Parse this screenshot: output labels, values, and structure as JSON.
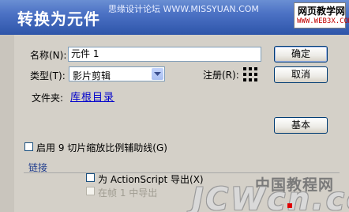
{
  "window": {
    "title": "转换为元件",
    "watermark_top": "思缘设计论坛 WWW.MISSYUAN.COM",
    "watermark_right_line1": "网页教学网",
    "watermark_right_line2": "WWW.WEB3X.COM"
  },
  "form": {
    "name_label": "名称(N):",
    "name_value": "元件 1",
    "type_label": "类型(T):",
    "type_value": "影片剪辑",
    "registration_label": "注册(R):",
    "folder_label": "文件夹:",
    "folder_link": "库根目录",
    "scale9_label": "启用 9 切片缩放比例辅助线(G)",
    "linkage_section": "链接",
    "export_actionscript_label": "为 ActionScript 导出(X)",
    "export_first_frame_label": "在帧 1 中导出"
  },
  "buttons": {
    "ok": "确定",
    "cancel": "取消",
    "basic": "基本"
  },
  "watermark_bottom": {
    "cn": "中国教程网",
    "en": "JCWcn.com"
  },
  "colors": {
    "titlebar": "#2e55a9",
    "dialog_bg": "#d4d0c8",
    "link": "#0000cc",
    "accent_red": "#e00000"
  }
}
